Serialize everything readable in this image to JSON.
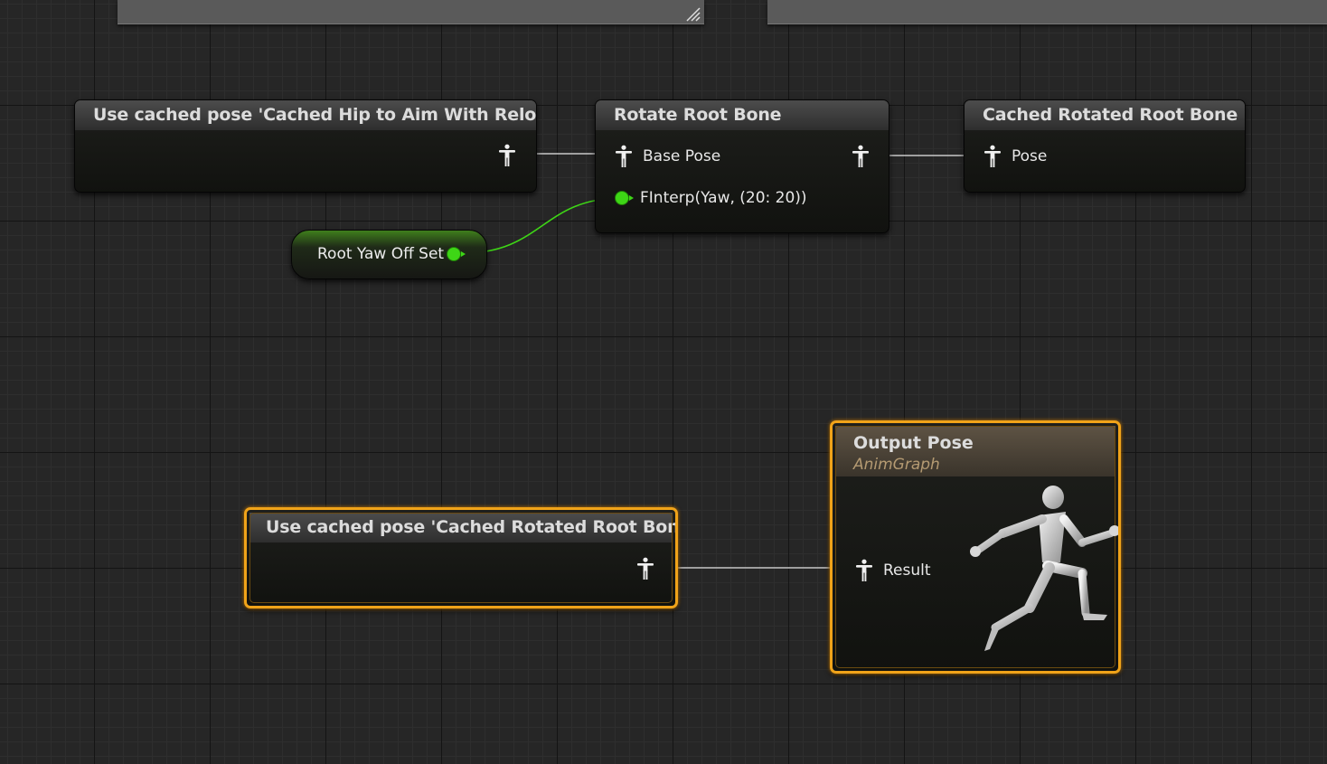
{
  "graph": {
    "nodes": {
      "cached_hip": {
        "title": "Use cached pose 'Cached Hip to Aim With Reload'"
      },
      "rotate_root": {
        "title": "Rotate Root Bone",
        "pins": {
          "base_pose": "Base Pose",
          "yaw": "FInterp(Yaw, (20: 20))"
        }
      },
      "cached_rotated": {
        "title": "Cached Rotated Root Bone",
        "pins": {
          "pose": "Pose"
        }
      },
      "root_yaw_var": {
        "label": "Root Yaw Off Set"
      },
      "cached_rotated_use": {
        "title": "Use cached pose 'Cached Rotated Root Bone'"
      },
      "output_pose": {
        "title": "Output Pose",
        "subtitle": "AnimGraph",
        "pins": {
          "result": "Result"
        }
      }
    },
    "colors": {
      "selection": "#f0a319",
      "float_pin": "#3ed616",
      "pose_wire": "#c8c8c8",
      "grid_major": "#141414",
      "grid_minor": "#2e2e2e",
      "background": "#262626"
    }
  }
}
